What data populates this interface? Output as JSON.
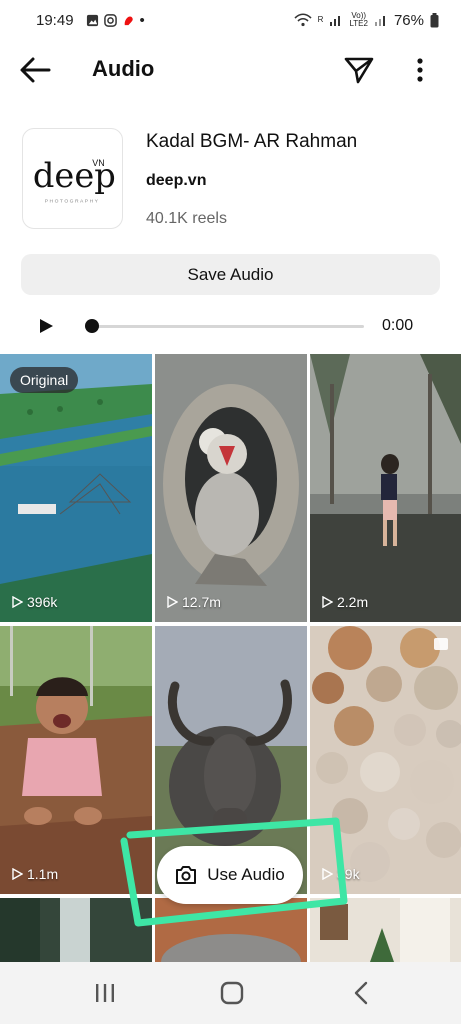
{
  "status": {
    "time": "19:49",
    "dot": "•",
    "signal_label_top": "R",
    "volte_label": "Vo))",
    "lte_label": "LTE2",
    "battery": "76%"
  },
  "app_bar": {
    "title": "Audio",
    "back_icon": "arrow-left-icon",
    "send_icon": "paper-plane-icon",
    "more_icon": "more-vertical-icon"
  },
  "audio": {
    "title": "Kadal BGM- AR Rahman",
    "artist": "deep.vn",
    "reels": "40.1K reels",
    "logo_text": "deep",
    "logo_sup": "VN",
    "logo_sub": "PHOTOGRAPHY"
  },
  "actions": {
    "save_label": "Save Audio",
    "use_label": "Use Audio"
  },
  "player": {
    "time": "0:00",
    "progress": 0
  },
  "reels": [
    {
      "count": "396k",
      "badge": "Original",
      "scene": "aerial-fishing-nets"
    },
    {
      "count": "12.7m",
      "scene": "owlet-in-tree-hole"
    },
    {
      "count": "2.2m",
      "scene": "girl-in-misty-forest"
    },
    {
      "count": "1.1m",
      "scene": "child-in-muddy-water"
    },
    {
      "count": "",
      "scene": "bull-with-horns"
    },
    {
      "count": "39k",
      "scene": "wall-of-plates"
    }
  ],
  "colors": {
    "highlight": "#3ee6a5",
    "button_bg": "#efefef",
    "nav_bg": "#f3f3f3"
  }
}
